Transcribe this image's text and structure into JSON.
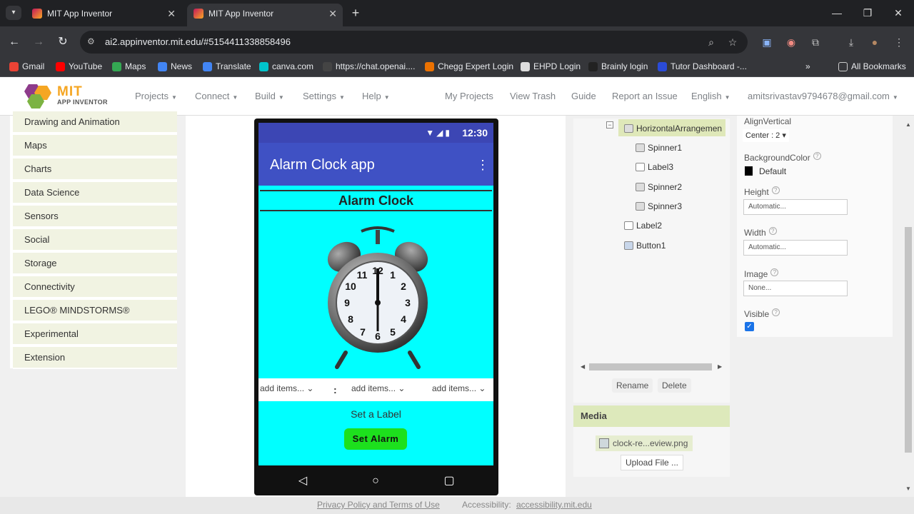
{
  "browser": {
    "tabs": [
      {
        "title": "MIT App Inventor",
        "active": false
      },
      {
        "title": "MIT App Inventor",
        "active": true
      }
    ],
    "url": "ai2.appinventor.mit.edu/#5154411338858496",
    "bookmarks": [
      {
        "label": "Gmail",
        "color": "#ea4335"
      },
      {
        "label": "YouTube",
        "color": "#ff0000"
      },
      {
        "label": "Maps",
        "color": "#34a853"
      },
      {
        "label": "News",
        "color": "#4285f4"
      },
      {
        "label": "Translate",
        "color": "#4285f4"
      },
      {
        "label": "canva.com",
        "color": "#00c4cc"
      },
      {
        "label": "https://chat.openai....",
        "color": "#444444"
      },
      {
        "label": "Chegg Expert Login",
        "color": "#eb7100"
      },
      {
        "label": "EHPD Login",
        "color": "#dddddd"
      },
      {
        "label": "Brainly login",
        "color": "#222222"
      },
      {
        "label": "Tutor Dashboard -...",
        "color": "#2a4bd8"
      }
    ],
    "all_bookmarks": "All Bookmarks"
  },
  "header": {
    "logo_title": "MIT",
    "logo_subtitle": "APP INVENTOR",
    "menus": [
      "Projects",
      "Connect",
      "Build",
      "Settings",
      "Help"
    ],
    "links": [
      "My Projects",
      "View Trash",
      "Guide",
      "Report an Issue"
    ],
    "language": "English",
    "account": "amitsrivastav9794678@gmail.com"
  },
  "palette": {
    "items": [
      "Drawing and Animation",
      "Maps",
      "Charts",
      "Data Science",
      "Sensors",
      "Social",
      "Storage",
      "Connectivity",
      "LEGO® MINDSTORMS®",
      "Experimental",
      "Extension"
    ]
  },
  "phone": {
    "time": "12:30",
    "app_title": "Alarm Clock app",
    "heading": "Alarm Clock",
    "spinners": [
      "add items...",
      "add items...",
      "add items..."
    ],
    "colon": ":",
    "label": "Set a Label",
    "button": "Set Alarm",
    "screen_color": "#00ffff",
    "button_color": "#1de01d"
  },
  "components": {
    "tree": [
      {
        "label": "HorizontalArrangemen",
        "selected": true
      },
      {
        "label": "Spinner1"
      },
      {
        "label": "Label3"
      },
      {
        "label": "Spinner2"
      },
      {
        "label": "Spinner3"
      },
      {
        "label": "Label2"
      },
      {
        "label": "Button1"
      }
    ],
    "rename": "Rename",
    "delete": "Delete"
  },
  "media": {
    "title": "Media",
    "file": "clock-re...eview.png",
    "upload": "Upload File ..."
  },
  "properties": {
    "align_vertical_label": "AlignVertical",
    "align_vertical_value": "Center : 2",
    "bgcolor_label": "BackgroundColor",
    "bgcolor_value": "Default",
    "height_label": "Height",
    "height_value": "Automatic...",
    "width_label": "Width",
    "width_value": "Automatic...",
    "image_label": "Image",
    "image_value": "None...",
    "visible_label": "Visible",
    "visible_checked": true
  },
  "footer": {
    "privacy": "Privacy Policy and Terms of Use",
    "accessibility_label": "Accessibility:",
    "accessibility_link": "accessibility.mit.edu"
  }
}
